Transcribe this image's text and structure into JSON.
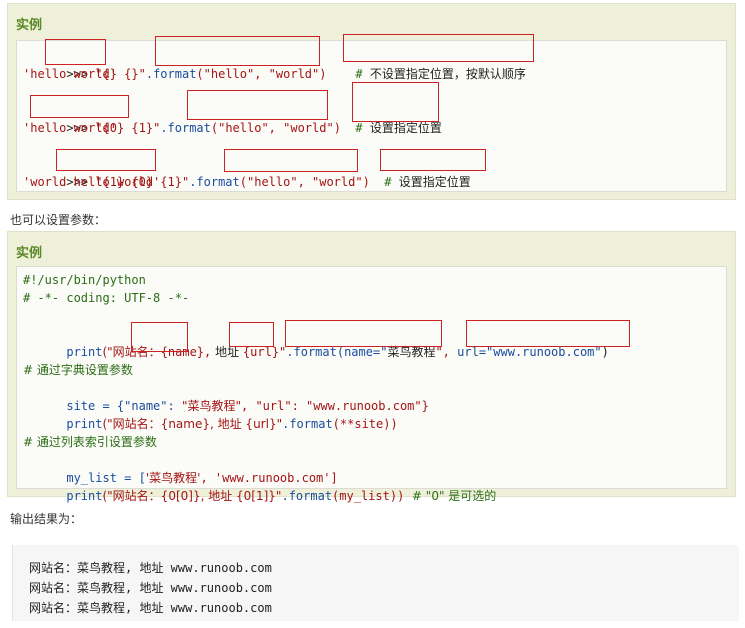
{
  "example1": {
    "title": "实例",
    "lines": [
      {
        "prompt": ">>> ",
        "str": "\"{} {}\"",
        "method": ".format",
        "args": "(\"hello\", \"world\")",
        "comment_hash": "# ",
        "comment": "不设置指定位置，按默认顺序"
      },
      {
        "output": "'hello world'"
      },
      {
        "prompt": ">>> ",
        "str": "\"{0} {1}\"",
        "method": ".format",
        "args": "(\"hello\", \"world\")",
        "comment_hash": "# ",
        "comment": "设置指定位置"
      },
      {
        "output": "'hello world'"
      },
      {
        "prompt": ">>> ",
        "str": "\"{1} {0} {1}\"",
        "method": ".format",
        "args": "(\"hello\", \"world\")",
        "comment_hash": "# ",
        "comment": "设置指定位置"
      },
      {
        "output": "'world hello world'"
      }
    ]
  },
  "para1": "也可以设置参数：",
  "example2": {
    "title": "实例",
    "shebang": "#!/usr/bin/python",
    "coding": "# -*- coding: UTF-8 -*-",
    "print1": {
      "kw": "print",
      "open": "(\"网站名：",
      "name": "{name}",
      "comma": ",",
      "mid": " 地址 ",
      "url": "{url}",
      "close": "\"",
      "format": ".format(name=\"",
      "brand": "菜鸟教程",
      "endq": "\",",
      "urlkw": "url=\"www.runoob.com\"",
      "paren": ")"
    },
    "comment_dict": "# 通过字典设置参数",
    "site_line_a": "site = {\"name\": ",
    "site_line_b": "\"菜鸟教程\"",
    "site_line_c": ", \"url\": \"www.runoob.com\"}",
    "print2_a": "print",
    "print2_b": "(\"网站名：{name}, 地址 {url}\"",
    "print2_c": ".format",
    "print2_d": "(**site))",
    "comment_list": "# 通过列表索引设置参数",
    "list_a": "my_list = [",
    "list_b": "'菜鸟教程'",
    "list_c": ", 'www.runoob.com']",
    "print3_a": "print",
    "print3_b": "(\"网站名：{0[0]}, 地址 {0[1]}\"",
    "print3_c": ".format",
    "print3_d": "(my_list))",
    "print3_comment": "  # \"0\" 是可选的"
  },
  "para2": "输出结果为：",
  "output_lines": [
    "网站名：菜鸟教程, 地址 www.runoob.com",
    "网站名：菜鸟教程, 地址 www.runoob.com",
    "网站名：菜鸟教程, 地址 www.runoob.com"
  ],
  "colors": {
    "accent": "#5b8a26",
    "highlight_box": "#cc2222",
    "string": "#a31515",
    "keyword": "#1a4c9d"
  }
}
